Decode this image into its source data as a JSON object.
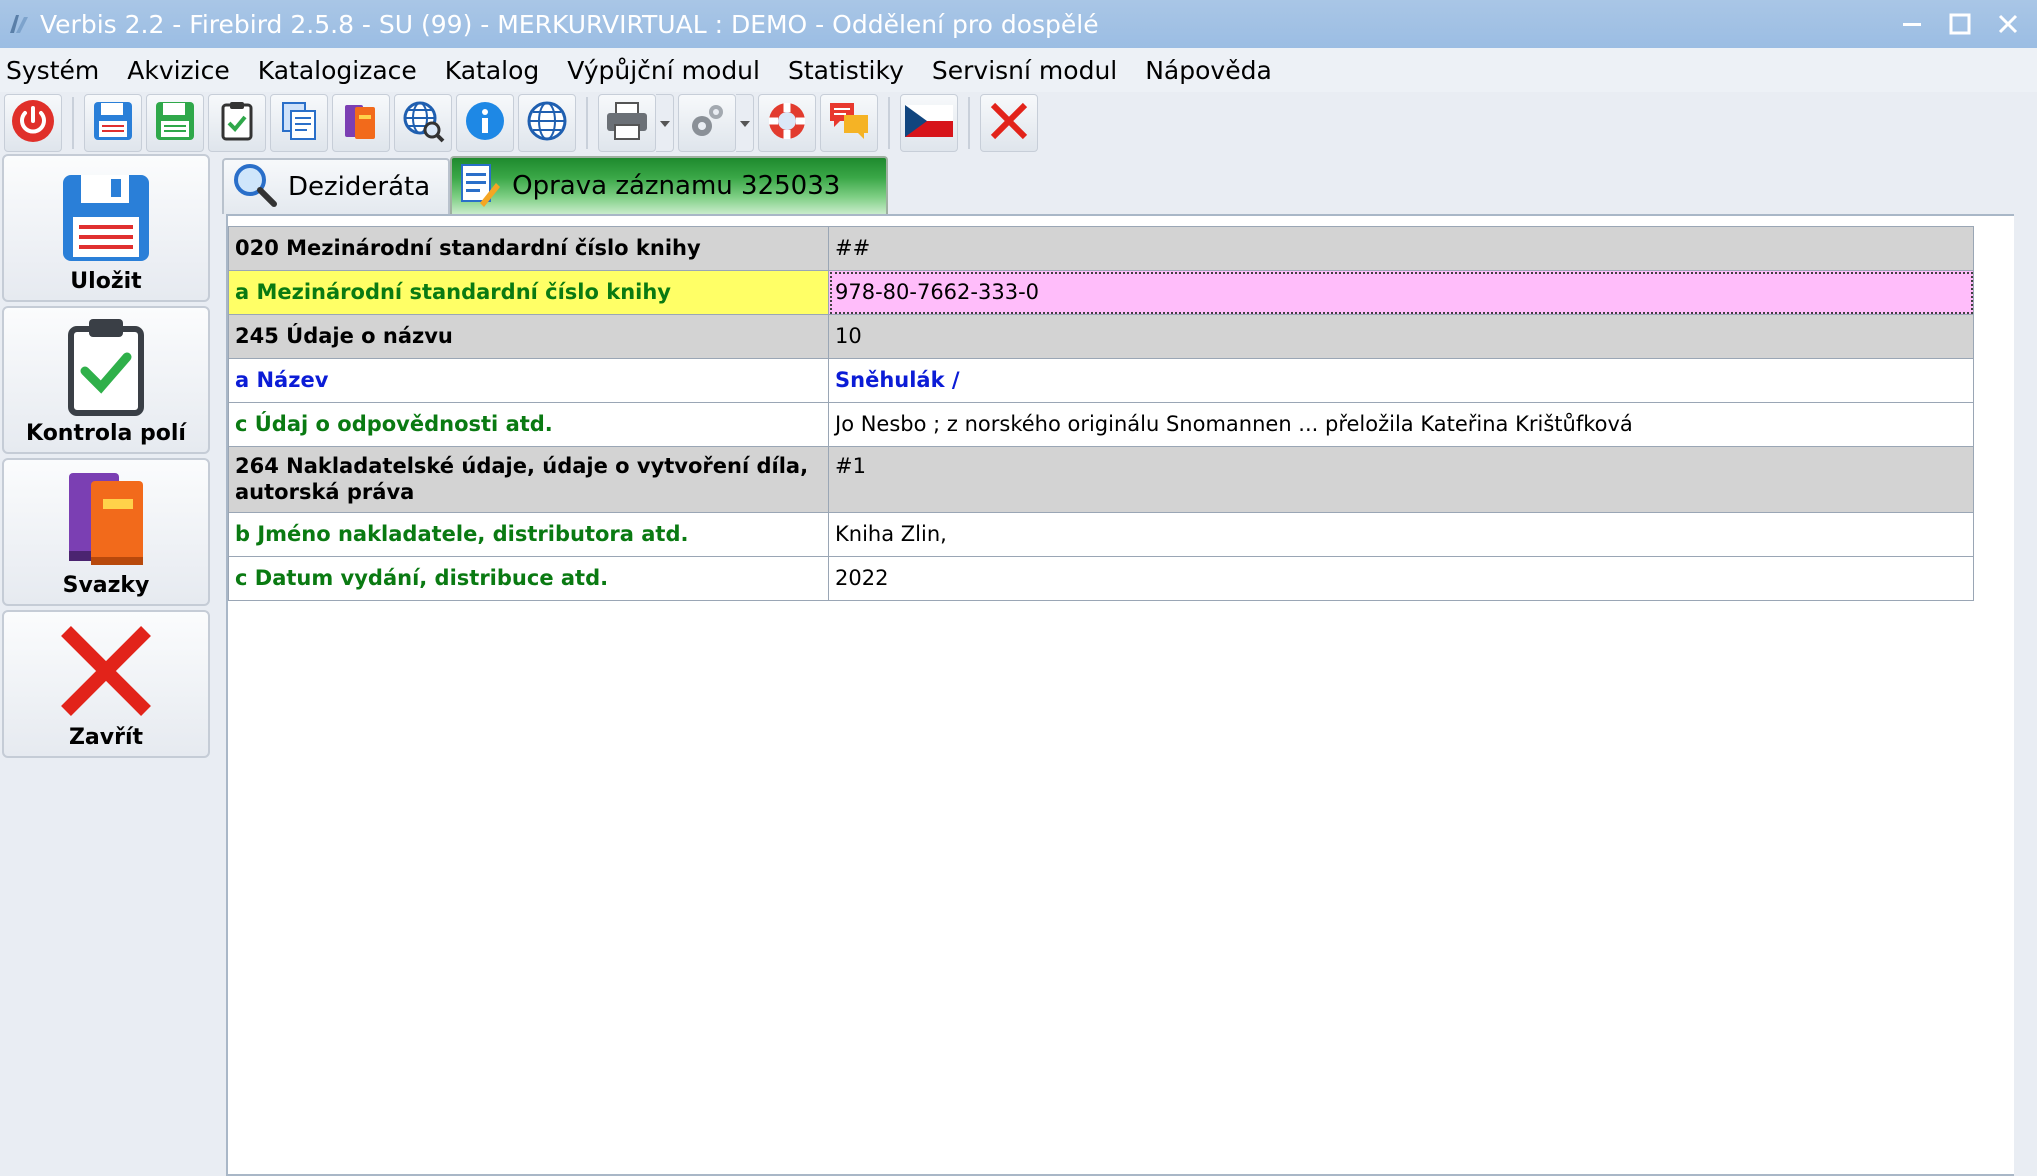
{
  "window": {
    "title": "Verbis 2.2 - Firebird 2.5.8 - SU (99) - MERKURVIRTUAL : DEMO - Oddělení pro dospělé"
  },
  "menu": {
    "items": [
      "Systém",
      "Akvizice",
      "Katalogizace",
      "Katalog",
      "Výpůjční modul",
      "Statistiky",
      "Servisní modul",
      "Nápověda"
    ]
  },
  "toolbar": {
    "buttons": [
      "power-icon",
      "save-icon",
      "save-green-icon",
      "clipboard-check-icon",
      "documents-icon",
      "books-icon",
      "globe-search-icon",
      "info-icon",
      "globe-icon",
      "printer-icon",
      "gears-icon",
      "lifebuoy-icon",
      "chat-bubbles-icon",
      "czech-flag-icon",
      "close-red-icon"
    ]
  },
  "side": {
    "save_label": "Uložit",
    "check_label": "Kontrola polí",
    "volumes_label": "Svazky",
    "close_label": "Zavřít"
  },
  "tabs": {
    "desiderata_label": "Dezideráta",
    "edit_label": "Oprava záznamu 325033"
  },
  "record": {
    "rows": [
      {
        "label": "020 Mezinárodní standardní číslo knihy",
        "value": "##"
      },
      {
        "label": "a Mezinárodní standardní číslo knihy",
        "value": "978-80-7662-333-0"
      },
      {
        "label": "245 Údaje o názvu",
        "value": "10"
      },
      {
        "label": "a Název",
        "value": "Sněhulák /"
      },
      {
        "label": "c Údaj o odpovědnosti atd.",
        "value": "Jo Nesbo ; z norského originálu Snomannen ... přeložila Kateřina Krištůfková"
      },
      {
        "label": "264 Nakladatelské údaje, údaje o vytvoření díla, autorská práva",
        "value": "#1"
      },
      {
        "label": "b Jméno nakladatele, distributora atd.",
        "value": "Kniha Zlin,"
      },
      {
        "label": "c Datum vydání, distribuce atd.",
        "value": "2022"
      }
    ]
  },
  "colors": {
    "titlebar": "#9bbde3",
    "active_tab": "#3aa747",
    "subfield_green": "#0a7a12",
    "subfield_blue": "#0b1cd6",
    "selected_label_bg": "#ffff66",
    "selected_value_bg": "#ffbdfa",
    "field_row_bg": "#d3d3d3"
  }
}
